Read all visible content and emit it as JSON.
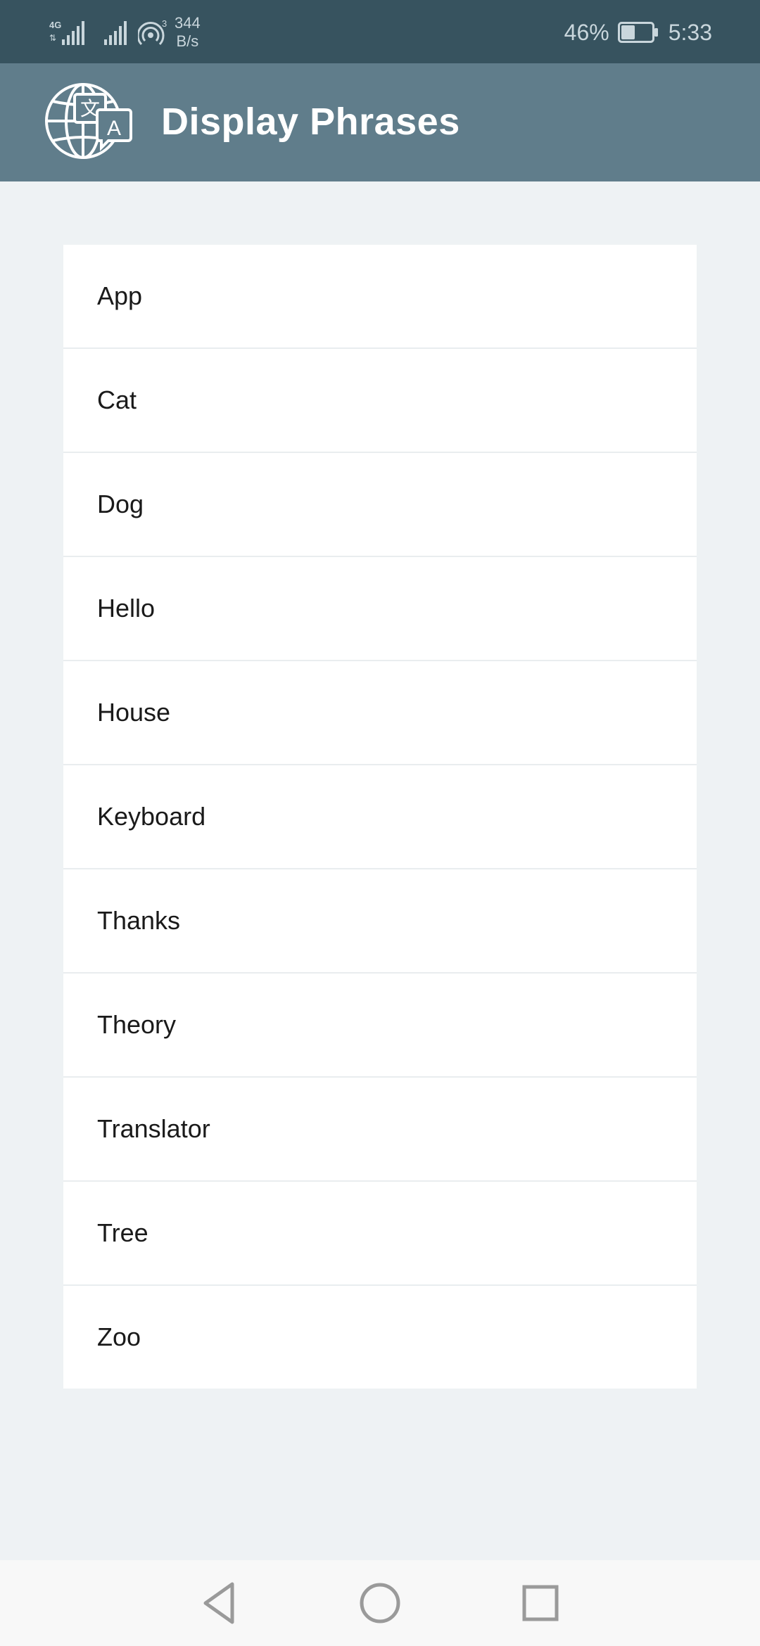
{
  "status_bar": {
    "network_type": "4G",
    "sim2_badge": "3",
    "net_speed_value": "344",
    "net_speed_unit": "B/s",
    "battery_percent": "46%",
    "battery_level": 0.46,
    "time": "5:33"
  },
  "app_bar": {
    "title": "Display Phrases",
    "logo_icon": "globe-translate-icon"
  },
  "phrases": [
    {
      "label": "App"
    },
    {
      "label": "Cat"
    },
    {
      "label": "Dog"
    },
    {
      "label": "Hello"
    },
    {
      "label": "House"
    },
    {
      "label": "Keyboard"
    },
    {
      "label": "Thanks"
    },
    {
      "label": "Theory"
    },
    {
      "label": "Translator"
    },
    {
      "label": "Tree"
    },
    {
      "label": "Zoo"
    }
  ],
  "nav_bar": {
    "back_icon": "back-triangle-icon",
    "home_icon": "home-circle-icon",
    "recents_icon": "recents-square-icon"
  },
  "colors": {
    "status_bar_bg": "#37535f",
    "app_bar_bg": "#607d8b",
    "page_bg": "#eef2f4",
    "list_bg": "#ffffff"
  }
}
